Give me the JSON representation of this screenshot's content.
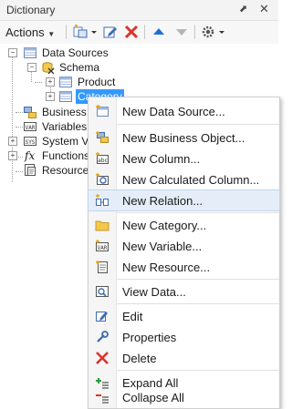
{
  "panel": {
    "title": "Dictionary",
    "pin_glyph": "⬈",
    "close_glyph": "✕"
  },
  "toolbar": {
    "actions_label": "Actions"
  },
  "tree": {
    "data_sources": "Data Sources",
    "schema": "Schema",
    "product": "Product",
    "category": "Category",
    "business_objects": "Business O",
    "variables": "Variables",
    "system_variables": "System Va",
    "functions": "Functions",
    "resources": "Resources",
    "fx_glyph": "fx",
    "expand_plus": "+",
    "expand_minus": "−"
  },
  "context_menu": {
    "new_data_source": "New Data Source...",
    "new_business_object": "New Business Object...",
    "new_column": "New Column...",
    "new_calculated_column": "New Calculated Column...",
    "new_relation": "New Relation...",
    "new_category": "New Category...",
    "new_variable": "New Variable...",
    "new_resource": "New Resource...",
    "view_data": "View Data...",
    "edit": "Edit",
    "properties": "Properties",
    "delete": "Delete",
    "expand_all": "Expand All",
    "collapse_all": "Collapse All",
    "highlighted_item": "New Relation..."
  },
  "colors": {
    "selection": "#3399ff",
    "menu_highlight": "#e5eef8",
    "delete_red": "#d9342b",
    "arrow_blue": "#1e6fd9"
  }
}
